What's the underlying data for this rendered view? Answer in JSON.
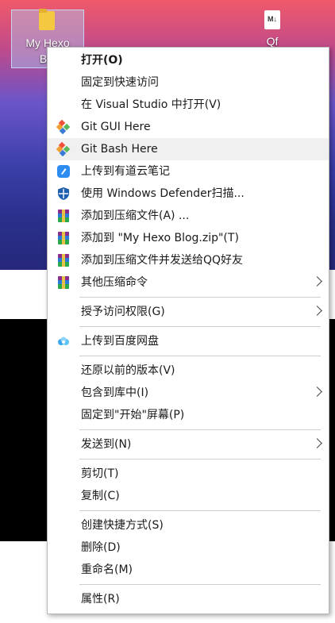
{
  "desktop": {
    "folder_label_line1": "My Hexo",
    "folder_label_line2": "Blo",
    "md_badge": "M↓",
    "md_label": "Qf"
  },
  "menu": {
    "items": [
      {
        "label": "打开(O)"
      },
      {
        "label": "固定到快速访问"
      },
      {
        "label": "在 Visual Studio 中打开(V)"
      },
      {
        "label": "Git GUI Here"
      },
      {
        "label": "Git Bash Here"
      },
      {
        "label": "上传到有道云笔记"
      },
      {
        "label": "使用 Windows Defender扫描..."
      },
      {
        "label": "添加到压缩文件(A) ..."
      },
      {
        "label": "添加到 \"My Hexo Blog.zip\"(T)"
      },
      {
        "label": "添加到压缩文件并发送给QQ好友"
      },
      {
        "label": "其他压缩命令"
      },
      {
        "label": "授予访问权限(G)"
      },
      {
        "label": "上传到百度网盘"
      },
      {
        "label": "还原以前的版本(V)"
      },
      {
        "label": "包含到库中(I)"
      },
      {
        "label": "固定到\"开始\"屏幕(P)"
      },
      {
        "label": "发送到(N)"
      },
      {
        "label": "剪切(T)"
      },
      {
        "label": "复制(C)"
      },
      {
        "label": "创建快捷方式(S)"
      },
      {
        "label": "删除(D)"
      },
      {
        "label": "重命名(M)"
      },
      {
        "label": "属性(R)"
      }
    ]
  },
  "colors": {
    "hover_background": "#f0f0f0",
    "separator": "#cfcfcf"
  }
}
